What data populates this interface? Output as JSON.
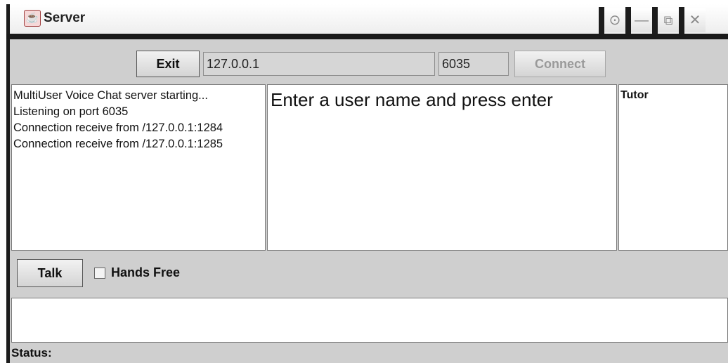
{
  "window": {
    "title": "Server",
    "app_icon": "java-cup-icon",
    "controls": [
      "restore-icon",
      "minimize-icon",
      "maximize-icon",
      "close-icon"
    ]
  },
  "connection": {
    "exit_label": "Exit",
    "host": "127.0.0.1",
    "port": "6035",
    "connect_label": "Connect"
  },
  "log": {
    "lines": [
      "MultiUser Voice Chat server starting...",
      "Listening on port 6035",
      "Connection receive from /127.0.0.1:1284",
      "Connection receive from /127.0.0.1:1285"
    ]
  },
  "chat": {
    "prompt": "Enter a user name and press enter"
  },
  "users": {
    "items": [
      "Tutor"
    ]
  },
  "controls": {
    "talk_label": "Talk",
    "hands_free_label": "Hands Free"
  },
  "status": {
    "label": "Status:"
  }
}
